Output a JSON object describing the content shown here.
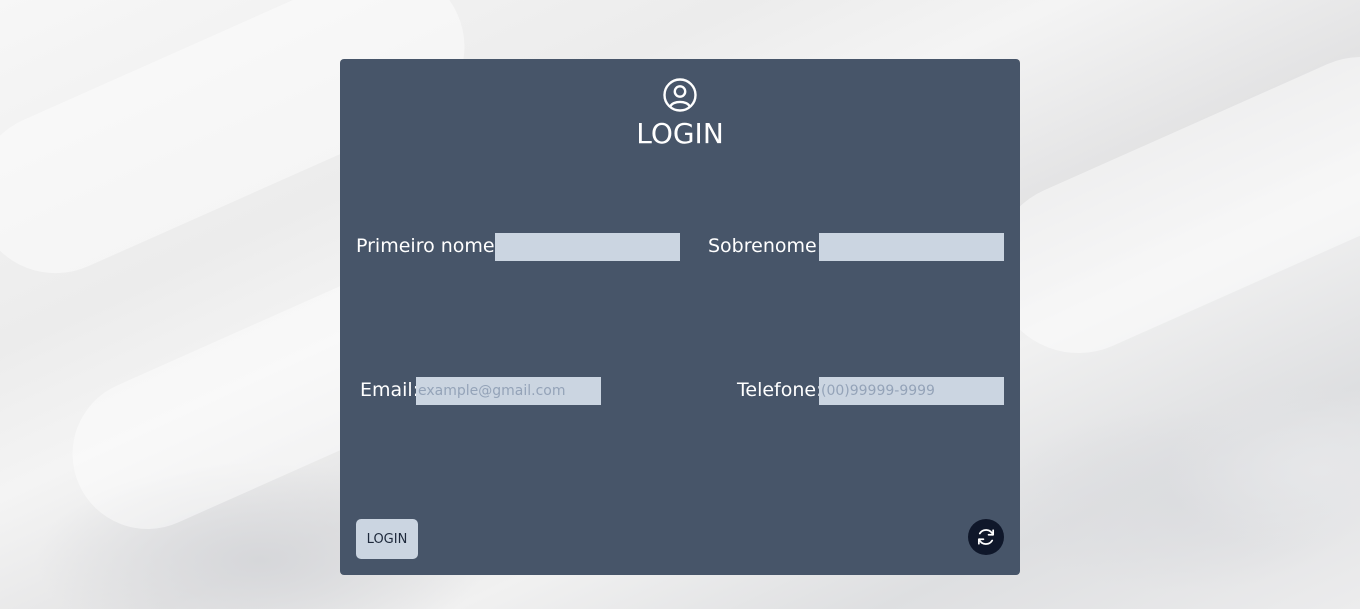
{
  "login_card": {
    "icon": "user-circle-icon",
    "title": "LOGIN"
  },
  "form": {
    "first_name": {
      "label": "Primeiro nome:",
      "value": "",
      "placeholder": ""
    },
    "last_name": {
      "label": "Sobrenome:",
      "value": "",
      "placeholder": ""
    },
    "email": {
      "label": "Email:",
      "value": "",
      "placeholder": "example@gmail.com"
    },
    "phone": {
      "label": "Telefone:",
      "value": "",
      "placeholder": "(00)99999-9999"
    }
  },
  "actions": {
    "login_label": "LOGIN",
    "refresh_icon": "refresh-icon"
  },
  "colors": {
    "card_background": "#475569",
    "input_background": "#cbd5e1",
    "refresh_button": "#0f172a"
  }
}
